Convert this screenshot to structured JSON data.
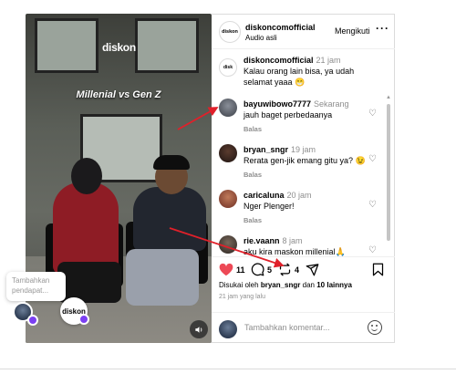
{
  "video": {
    "logo_text": "diskon",
    "caption": "Millenial vs Gen Z"
  },
  "popup": {
    "tooltip_text": "Tambahkan pendapat...",
    "brand_text": "diskon"
  },
  "post": {
    "username": "diskoncomofficial",
    "audio_label": "Audio asli",
    "follow_label": "Mengikuti",
    "more_icon": "more-horizontal-icon",
    "avatar_text": "diskon"
  },
  "comments": [
    {
      "user": "diskoncomofficial",
      "time": "21 jam",
      "text": "Kalau orang lain bisa, ya udah selamat yaaa 😁",
      "reply_label": ""
    },
    {
      "user": "bayuwibowo7777",
      "time": "Sekarang",
      "text": "jauh baget perbedaanya",
      "reply_label": "Balas"
    },
    {
      "user": "bryan_sngr",
      "time": "19 jam",
      "text": "Rerata gen-jik emang gitu ya? 😉",
      "reply_label": "Balas"
    },
    {
      "user": "caricaluna",
      "time": "20 jam",
      "text": "Nger Plenger!",
      "reply_label": "Balas"
    },
    {
      "user": "rie.vaann",
      "time": "8 jam",
      "text": "aku kira maskon millenial🙏",
      "reply_label": ""
    }
  ],
  "actions": {
    "like_count": "11",
    "comment_count": "5",
    "repost_count": "4",
    "like_color": "#ed4956"
  },
  "likes": {
    "prefix": "Disukai oleh",
    "user": "bryan_sngr",
    "connector": "dan",
    "others": "10 lainnya"
  },
  "time_ago": "21 jam yang lalu",
  "add_comment": {
    "placeholder": "Tambahkan komentar..."
  }
}
